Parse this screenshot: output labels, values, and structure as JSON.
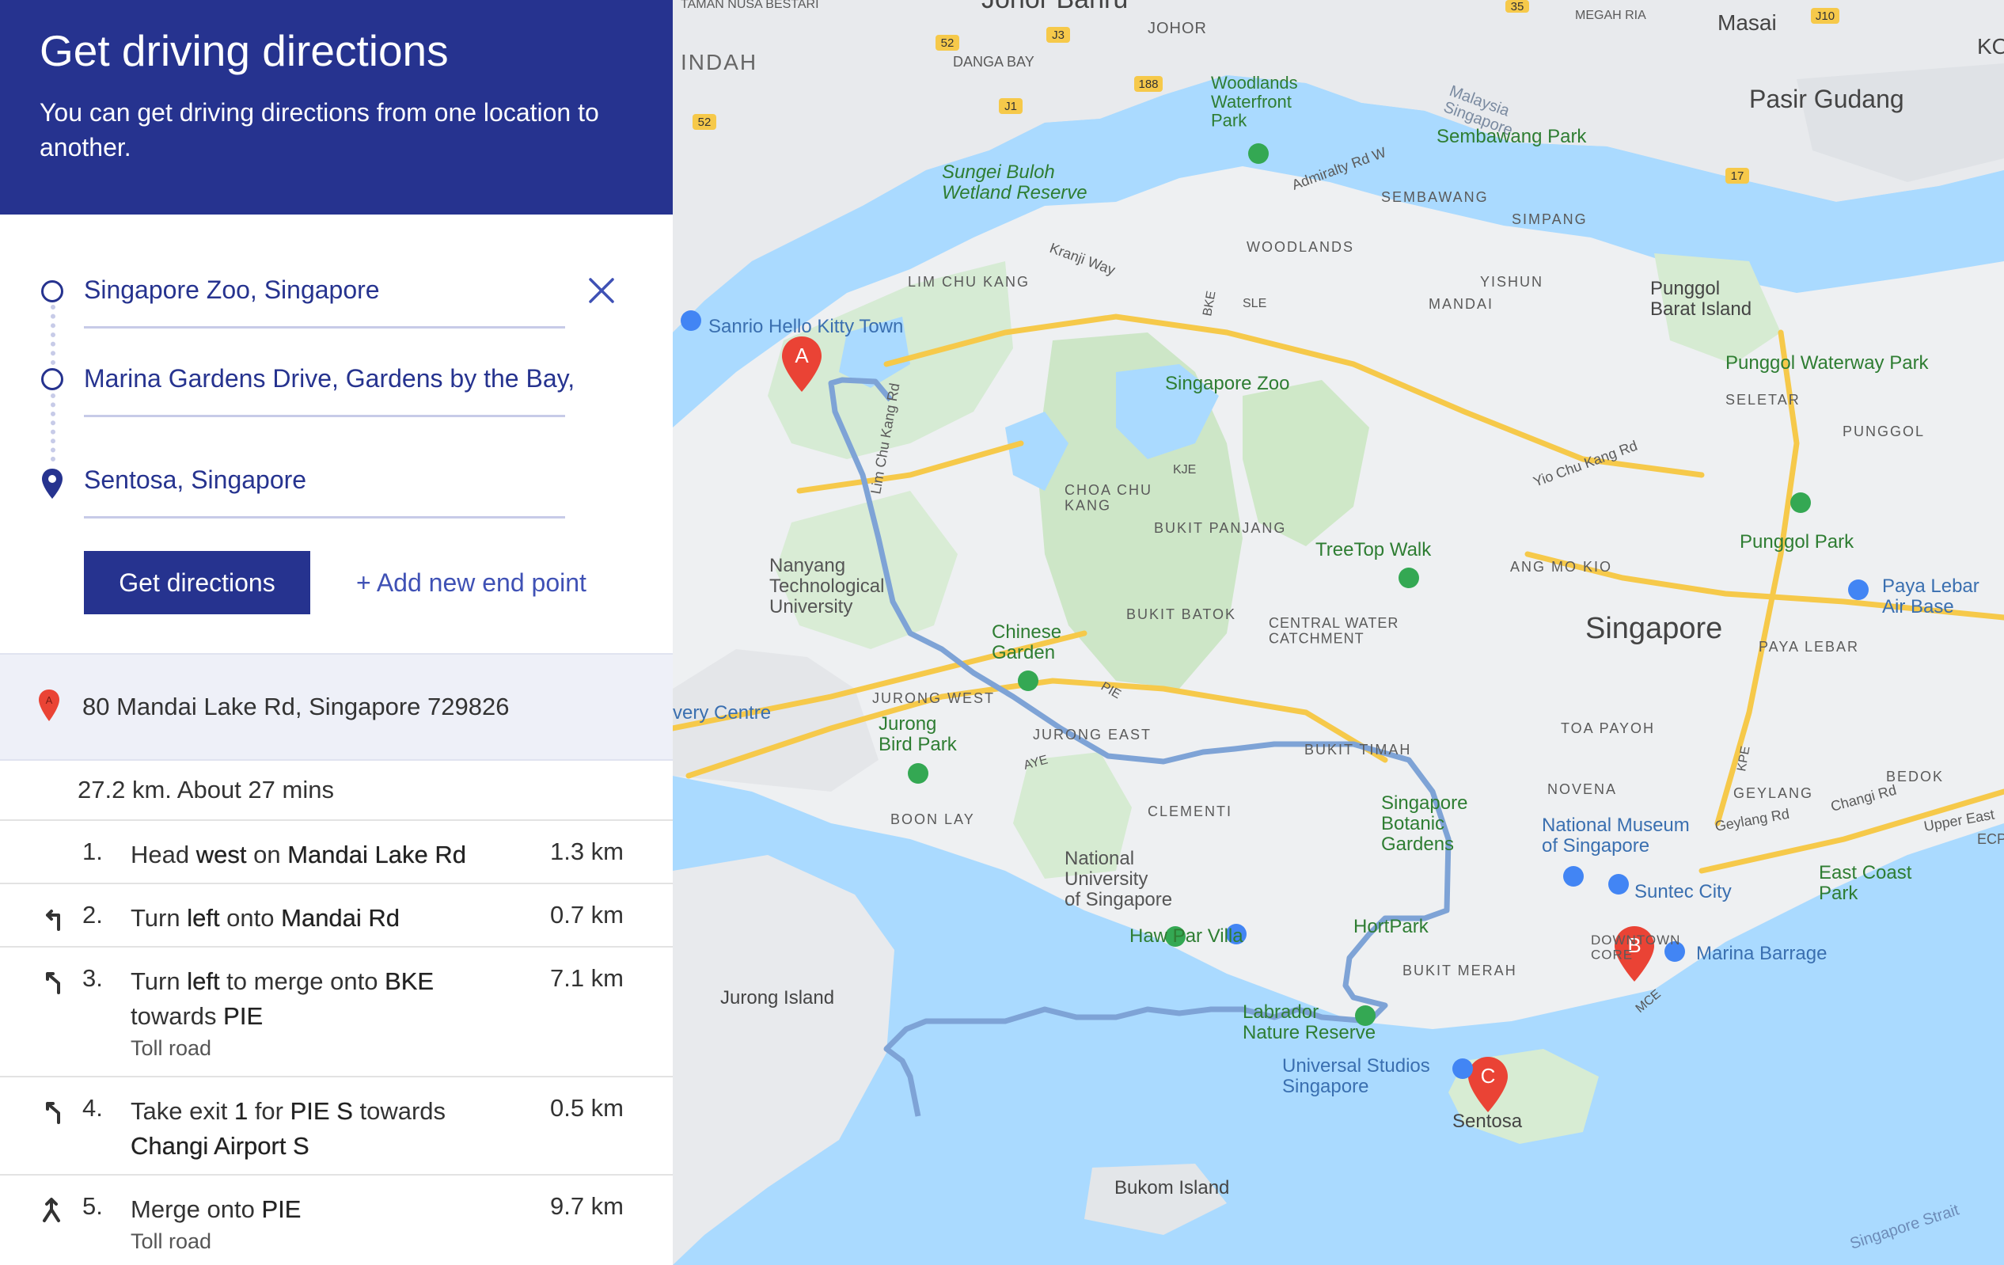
{
  "header": {
    "title": "Get driving directions",
    "subtitle": "You can get driving directions from one location to another."
  },
  "waypoints": [
    {
      "text": "Singapore Zoo, Singapore"
    },
    {
      "text": "Marina Gardens Drive, Gardens by the Bay,"
    },
    {
      "text": "Sentosa, Singapore"
    }
  ],
  "buttons": {
    "get_directions": "Get directions",
    "add_end_point": "+ Add new end point"
  },
  "start_marker_letter": "A",
  "start_address": "80 Mandai Lake Rd, Singapore 729826",
  "summary": "27.2 km. About 27 mins",
  "steps": [
    {
      "num": "1.",
      "parts": [
        "Head ",
        "west",
        " on ",
        "Mandai Lake Rd"
      ],
      "note": "",
      "distance": "1.3 km",
      "icon": "none"
    },
    {
      "num": "2.",
      "parts": [
        "Turn ",
        "left",
        " onto ",
        "Mandai Rd"
      ],
      "note": "",
      "distance": "0.7 km",
      "icon": "turn-left-icon"
    },
    {
      "num": "3.",
      "parts": [
        "Turn ",
        "left",
        " to merge onto ",
        "BKE",
        " towards ",
        "PIE"
      ],
      "note": "Toll road",
      "distance": "7.1 km",
      "icon": "merge-left-icon"
    },
    {
      "num": "4.",
      "parts": [
        "Take exit ",
        "1",
        " for ",
        "PIE S",
        " towards ",
        "Changi Airport S"
      ],
      "note": "",
      "distance": "0.5 km",
      "icon": "exit-left-icon"
    },
    {
      "num": "5.",
      "parts": [
        "Merge onto ",
        "PIE"
      ],
      "note": "Toll road",
      "distance": "9.7 km",
      "icon": "merge-icon"
    }
  ],
  "map": {
    "markers": [
      {
        "letter": "A",
        "name": "marker-a"
      },
      {
        "letter": "B",
        "name": "marker-b"
      },
      {
        "letter": "C",
        "name": "marker-c"
      }
    ],
    "labels": {
      "johor_bahru": "Johor Bahru",
      "taman_nusa_bestari": "TAMAN NUSA BESTARI",
      "indah": "INDAH",
      "johor": "JOHOR",
      "danga_bay": "DANGA BAY",
      "woodlands_waterfront": "Woodlands Waterfront Park",
      "malaysia_singapore": "Malaysia Singapore",
      "masai": "Masai",
      "megah_ria": "MEGAH RIA",
      "pasir_gudang": "Pasir Gudang",
      "ko": "KO",
      "sembawang_park": "Sembawang Park",
      "admiralty_rd_w": "Admiralty Rd W",
      "sungei_buloh": "Sungei Buloh Wetland Reserve",
      "sembawang": "SEMBAWANG",
      "simpang": "SIMPANG",
      "woodlands": "WOODLANDS",
      "kranji_way": "Kranji Way",
      "lim_chu_kang": "LIM CHU KANG",
      "yishun": "YISHUN",
      "mandai": "MANDAI",
      "punggol_barat": "Punggol Barat Island",
      "sanrio": "Sanrio Hello Kitty Town",
      "singapore_zoo": "Singapore Zoo",
      "punggol_waterway": "Punggol Waterway Park",
      "seletar": "SELETAR",
      "punggol": "PUNGGOL",
      "yio_chu_kang_rd": "Yio Chu Kang Rd",
      "lim_chu_kang_rd": "Lim Chu Kang Rd",
      "choa_chu_kang": "CHOA CHU KANG",
      "bukit_panjang": "BUKIT PANJANG",
      "punggol_park": "Punggol Park",
      "treetop_walk": "TreeTop Walk",
      "ang_mo_kio": "ANG MO KIO",
      "paya_lebar_air_base": "Paya Lebar Air Base",
      "nanyang": "Nanyang Technological University",
      "chinese_garden": "Chinese Garden",
      "bukit_batok": "BUKIT BATOK",
      "central_water": "CENTRAL WATER CATCHMENT",
      "singapore": "Singapore",
      "paya_lebar": "PAYA LEBAR",
      "jurong_west": "JURONG WEST",
      "discovery_centre": "very Centre",
      "jurong_bird_park": "Jurong Bird Park",
      "jurong_east": "JURONG EAST",
      "bukit_timah": "BUKIT TIMAH",
      "toa_payoh": "TOA PAYOH",
      "boon_lay": "BOON LAY",
      "clementi": "CLEMENTI",
      "novena": "NOVENA",
      "geylang": "GEYLANG",
      "bedok": "BEDOK",
      "singapore_botanic": "Singapore Botanic Gardens",
      "national_museum": "National Museum of Singapore",
      "geylang_rd": "Geylang Rd",
      "changi_rd": "Changi Rd",
      "upper_east": "Upper East",
      "ecp": "ECP",
      "nus": "National University of Singapore",
      "suntec_city": "Suntec City",
      "east_coast_park": "East Coast Park",
      "haw_par_villa": "Haw Par Villa",
      "hortpark": "HortPark",
      "downtown_core": "DOWNTOWN CORE",
      "marina_barrage": "Marina Barrage",
      "jurong_island": "Jurong Island",
      "bukit_merah": "BUKIT MERAH",
      "labrador": "Labrador Nature Reserve",
      "universal_studios": "Universal Studios Singapore",
      "sentosa": "Sentosa",
      "bukom_island": "Bukom Island",
      "singapore_strait": "Singapore Strait"
    },
    "road_labels": {
      "bke": "BKE",
      "sle": "SLE",
      "kje": "KJE",
      "pie": "PIE",
      "aye": "AYE",
      "kpe": "KPE",
      "mce": "MCE"
    },
    "shields": {
      "s52a": "52",
      "s52b": "52",
      "j3": "J3",
      "s188": "188",
      "j1": "J1",
      "s35": "35",
      "j10": "J10",
      "s17": "17"
    }
  }
}
